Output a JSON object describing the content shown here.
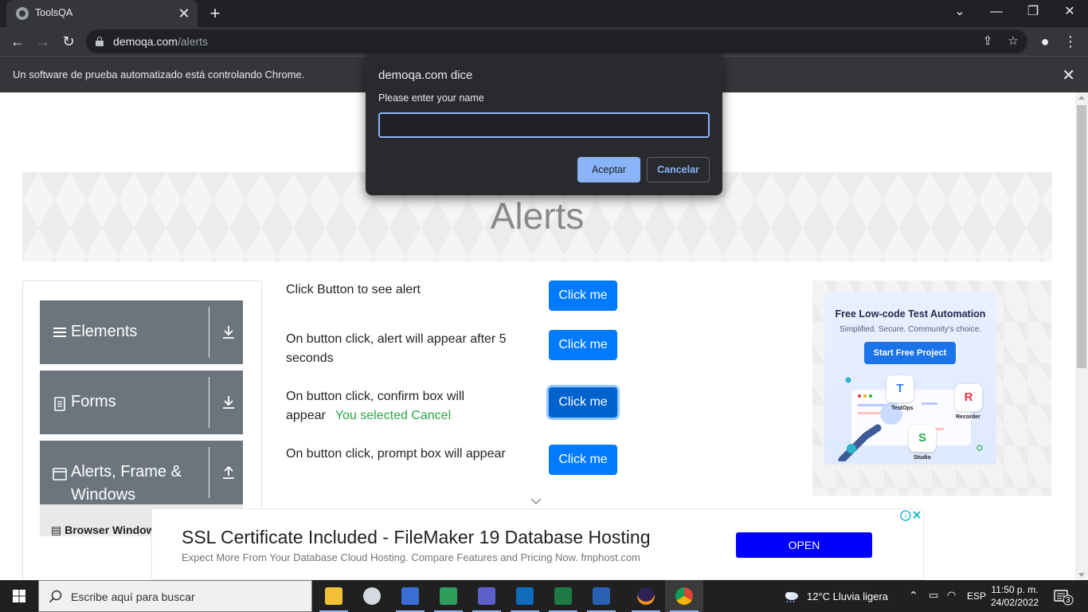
{
  "browser": {
    "tab_title": "ToolsQA",
    "url_domain": "demoqa.com",
    "url_path": "/alerts",
    "infobar_message": "Un software de prueba automatizado está controlando Chrome."
  },
  "page": {
    "title": "Alerts",
    "sidebar": {
      "groups": [
        {
          "label": "Elements",
          "icon": "hamburger-icon",
          "expanded": false
        },
        {
          "label": "Forms",
          "icon": "document-icon",
          "expanded": false
        },
        {
          "label": "Alerts, Frame & Windows",
          "icon": "window-icon",
          "expanded": true
        }
      ],
      "visible_subitem": "Browser Windows"
    },
    "rows": [
      {
        "label": "Click Button to see alert",
        "button": "Click me"
      },
      {
        "label": "On button click, alert will appear after 5 seconds",
        "button": "Click me"
      },
      {
        "label": "On button click, confirm box will appear",
        "result": "You selected Cancel",
        "button": "Click me"
      },
      {
        "label": "On button click, prompt box will appear",
        "button": "Click me"
      }
    ]
  },
  "side_ad": {
    "title": "Free Low-code Test Automation",
    "subtitle": "Simplified. Secure. Community's choice.",
    "cta": "Start Free Project",
    "tools": [
      {
        "letter": "T",
        "name": "TestOps",
        "color": "#2d7ff9"
      },
      {
        "letter": "R",
        "name": "Recorder",
        "color": "#e8333f"
      },
      {
        "letter": "S",
        "name": "Studio",
        "color": "#27b24a"
      }
    ]
  },
  "bottom_ad": {
    "headline": "SSL Certificate Included - FileMaker 19 Database Hosting",
    "description": "Expect More From Your Database Cloud Hosting. Compare Features and Pricing Now. fmphost.com",
    "cta": "OPEN"
  },
  "dialog": {
    "title": "demoqa.com dice",
    "message": "Please enter your name",
    "input_value": "",
    "accept_label": "Aceptar",
    "cancel_label": "Cancelar"
  },
  "taskbar": {
    "search_placeholder": "Escribe aquí para buscar",
    "weather": "12°C  Lluvia ligera",
    "language": "ESP",
    "time": "11:50 p. m.",
    "date": "24/02/2022",
    "notifications": "3",
    "apps": [
      "file-explorer-icon",
      "snipping-icon",
      "network-icon",
      "media-icon",
      "teams-icon",
      "outlook-icon",
      "excel-icon",
      "word-icon",
      "eclipse-icon",
      "chrome-icon"
    ]
  },
  "colors": {
    "primary_button": "#007bff",
    "sidebar_group": "#6c757d",
    "success_text": "#28a745",
    "dialog_accent": "#8ab4f8"
  }
}
